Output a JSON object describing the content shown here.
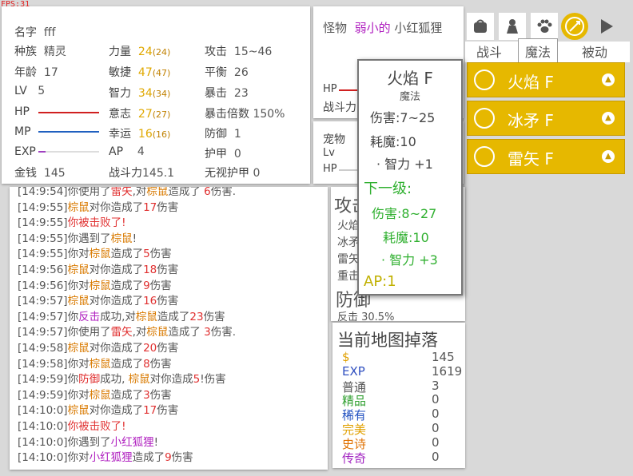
{
  "fps": "FPS:31",
  "stats": {
    "name_label": "名字",
    "name_value": "fff",
    "race_label": "种族",
    "race_value": "精灵",
    "age_label": "年龄",
    "age_value": "17",
    "lv_label": "LV",
    "lv_value": "5",
    "hp_label": "HP",
    "mp_label": "MP",
    "exp_label": "EXP",
    "hp_fill": 1.0,
    "mp_fill": 1.0,
    "exp_fill": 0.12,
    "gold_label": "金钱",
    "gold_value": "145",
    "str_label": "力量",
    "str_value": "24",
    "str_base": "(24)",
    "agi_label": "敏捷",
    "agi_value": "47",
    "agi_base": "(47)",
    "int_label": "智力",
    "int_value": "34",
    "int_base": "(34)",
    "will_label": "意志",
    "will_value": "27",
    "will_base": "(27)",
    "luck_label": "幸运",
    "luck_value": "16",
    "luck_base": "(16)",
    "ap_label": "AP",
    "ap_value": "4",
    "power_label": "战斗力",
    "power_value": "145.1",
    "atk_label": "攻击",
    "atk_value": "15~46",
    "bal_label": "平衡",
    "bal_value": "26",
    "crit_label": "暴击",
    "crit_value": "23",
    "critx_label": "暴击倍数",
    "critx_value": "150%",
    "def_label": "防御",
    "def_value": "1",
    "armor_label": "护甲",
    "armor_value": "0",
    "pierce_label": "无视护甲",
    "pierce_value": "0"
  },
  "monster": {
    "label": "怪物",
    "prefix": "弱小的",
    "name": "小红狐狸",
    "hp_label": "HP",
    "power_label": "战斗力"
  },
  "pet": {
    "label": "宠物",
    "lv_label": "Lv",
    "hp_label": "HP"
  },
  "log": [
    {
      "t": "[14:9:54]",
      "parts": [
        {
          "s": "你使用了"
        },
        {
          "s": "雷矢",
          "c": "red"
        },
        {
          "s": ",对"
        },
        {
          "s": "棕鼠",
          "c": "orange"
        },
        {
          "s": "造成了 "
        },
        {
          "s": "6",
          "c": "red"
        },
        {
          "s": "伤害."
        }
      ]
    },
    {
      "t": "[14:9:55]",
      "parts": [
        {
          "s": "棕鼠",
          "c": "orange"
        },
        {
          "s": "对你造成了"
        },
        {
          "s": "17",
          "c": "red"
        },
        {
          "s": "伤害"
        }
      ]
    },
    {
      "t": "[14:9:55]",
      "parts": [
        {
          "s": "你被击败了!",
          "c": "red"
        }
      ]
    },
    {
      "t": "[14:9:55]",
      "parts": [
        {
          "s": "你遇到了"
        },
        {
          "s": "棕鼠",
          "c": "orange"
        },
        {
          "s": "!"
        }
      ]
    },
    {
      "t": "[14:9:55]",
      "parts": [
        {
          "s": "你对"
        },
        {
          "s": "棕鼠",
          "c": "orange"
        },
        {
          "s": "造成了"
        },
        {
          "s": "5",
          "c": "red"
        },
        {
          "s": "伤害"
        }
      ]
    },
    {
      "t": "[14:9:56]",
      "parts": [
        {
          "s": "棕鼠",
          "c": "orange"
        },
        {
          "s": "对你造成了"
        },
        {
          "s": "18",
          "c": "red"
        },
        {
          "s": "伤害"
        }
      ]
    },
    {
      "t": "[14:9:56]",
      "parts": [
        {
          "s": "你对"
        },
        {
          "s": "棕鼠",
          "c": "orange"
        },
        {
          "s": "造成了"
        },
        {
          "s": "9",
          "c": "red"
        },
        {
          "s": "伤害"
        }
      ]
    },
    {
      "t": "[14:9:57]",
      "parts": [
        {
          "s": "棕鼠",
          "c": "orange"
        },
        {
          "s": "对你造成了"
        },
        {
          "s": "16",
          "c": "red"
        },
        {
          "s": "伤害"
        }
      ]
    },
    {
      "t": "[14:9:57]",
      "parts": [
        {
          "s": "你"
        },
        {
          "s": "反击",
          "c": "purple"
        },
        {
          "s": "成功,对"
        },
        {
          "s": "棕鼠",
          "c": "orange"
        },
        {
          "s": "造成了"
        },
        {
          "s": "23",
          "c": "red"
        },
        {
          "s": "伤害"
        }
      ]
    },
    {
      "t": "[14:9:57]",
      "parts": [
        {
          "s": "你使用了"
        },
        {
          "s": "雷矢",
          "c": "red"
        },
        {
          "s": ",对"
        },
        {
          "s": "棕鼠",
          "c": "orange"
        },
        {
          "s": "造成了 "
        },
        {
          "s": "3",
          "c": "red"
        },
        {
          "s": "伤害."
        }
      ]
    },
    {
      "t": "[14:9:58]",
      "parts": [
        {
          "s": "棕鼠",
          "c": "orange"
        },
        {
          "s": "对你造成了"
        },
        {
          "s": "20",
          "c": "red"
        },
        {
          "s": "伤害"
        }
      ]
    },
    {
      "t": "[14:9:58]",
      "parts": [
        {
          "s": "你对"
        },
        {
          "s": "棕鼠",
          "c": "orange"
        },
        {
          "s": "造成了"
        },
        {
          "s": "8",
          "c": "red"
        },
        {
          "s": "伤害"
        }
      ]
    },
    {
      "t": "[14:9:59]",
      "parts": [
        {
          "s": "你"
        },
        {
          "s": "防御",
          "c": "red"
        },
        {
          "s": "成功, "
        },
        {
          "s": "棕鼠",
          "c": "orange"
        },
        {
          "s": "对你造成"
        },
        {
          "s": "5",
          "c": "red"
        },
        {
          "s": "!伤害"
        }
      ]
    },
    {
      "t": "[14:9:59]",
      "parts": [
        {
          "s": "你对"
        },
        {
          "s": "棕鼠",
          "c": "orange"
        },
        {
          "s": "造成了"
        },
        {
          "s": "3",
          "c": "red"
        },
        {
          "s": "伤害"
        }
      ]
    },
    {
      "t": "[14:10:0]",
      "parts": [
        {
          "s": "棕鼠",
          "c": "orange"
        },
        {
          "s": "对你造成了"
        },
        {
          "s": "17",
          "c": "red"
        },
        {
          "s": "伤害"
        }
      ]
    },
    {
      "t": "[14:10:0]",
      "parts": [
        {
          "s": "你被击败了!",
          "c": "red"
        }
      ]
    },
    {
      "t": "[14:10:0]",
      "parts": [
        {
          "s": "你遇到了"
        },
        {
          "s": "小红狐狸",
          "c": "purple"
        },
        {
          "s": "!"
        }
      ]
    },
    {
      "t": "[14:10:0]",
      "parts": [
        {
          "s": "你对"
        },
        {
          "s": "小红狐狸",
          "c": "purple"
        },
        {
          "s": "造成了"
        },
        {
          "s": "9",
          "c": "red"
        },
        {
          "s": "伤害"
        }
      ]
    }
  ],
  "attack": {
    "title": "攻击",
    "rows": [
      "火焰",
      "冰矛",
      "雷矢",
      "重击"
    ],
    "defense_title": "防御",
    "counter": "反击 30.5%"
  },
  "drops": {
    "title": "当前地图掉落",
    "rows": [
      {
        "label": "$",
        "value": "145",
        "color": "#e0a000"
      },
      {
        "label": "EXP",
        "value": "1619",
        "color": "#3050c0"
      },
      {
        "label": "普通",
        "value": "3",
        "color": "#555555"
      },
      {
        "label": "精品",
        "value": "0",
        "color": "#30a030"
      },
      {
        "label": "稀有",
        "value": "0",
        "color": "#2050c0"
      },
      {
        "label": "完美",
        "value": "0",
        "color": "#e0a000"
      },
      {
        "label": "史诗",
        "value": "0",
        "color": "#e07000"
      },
      {
        "label": "传奇",
        "value": "0",
        "color": "#a020c0"
      }
    ]
  },
  "skills": {
    "tabs": [
      "战斗",
      "魔法",
      "被动"
    ],
    "icons": [
      "bag-icon",
      "character-icon",
      "paw-icon",
      "magic-icon",
      "play-icon"
    ],
    "list": [
      "火焰 F",
      "冰矛 F",
      "雷矢 F"
    ],
    "accent": "#e6b800"
  },
  "tooltip": {
    "title": "火焰 F",
    "type": "魔法",
    "damage": "伤害:7~25",
    "cost": "耗魔:10",
    "bonus": "· 智力 +1",
    "next_title": "下一级:",
    "next_damage": "伤害:8~27",
    "next_cost": "耗魔:10",
    "next_bonus": "· 智力 +3",
    "ap": "AP:1"
  }
}
